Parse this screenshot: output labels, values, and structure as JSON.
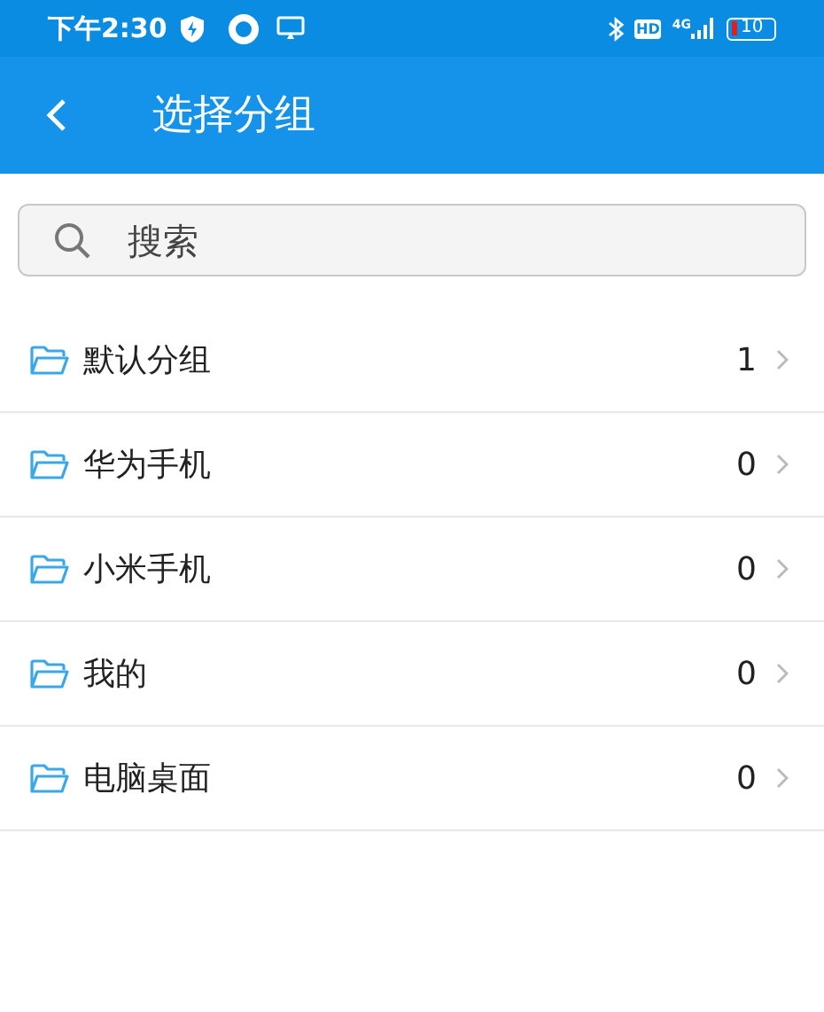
{
  "status_bar": {
    "time": "下午2:30",
    "hd": "HD",
    "network": "4G",
    "battery": "10"
  },
  "header": {
    "title": "选择分组"
  },
  "search": {
    "placeholder": "搜索"
  },
  "groups": [
    {
      "name": "默认分组",
      "count": "1"
    },
    {
      "name": "华为手机",
      "count": "0"
    },
    {
      "name": "小米手机",
      "count": "0"
    },
    {
      "name": "我的",
      "count": "0"
    },
    {
      "name": "电脑桌面",
      "count": "0"
    }
  ]
}
